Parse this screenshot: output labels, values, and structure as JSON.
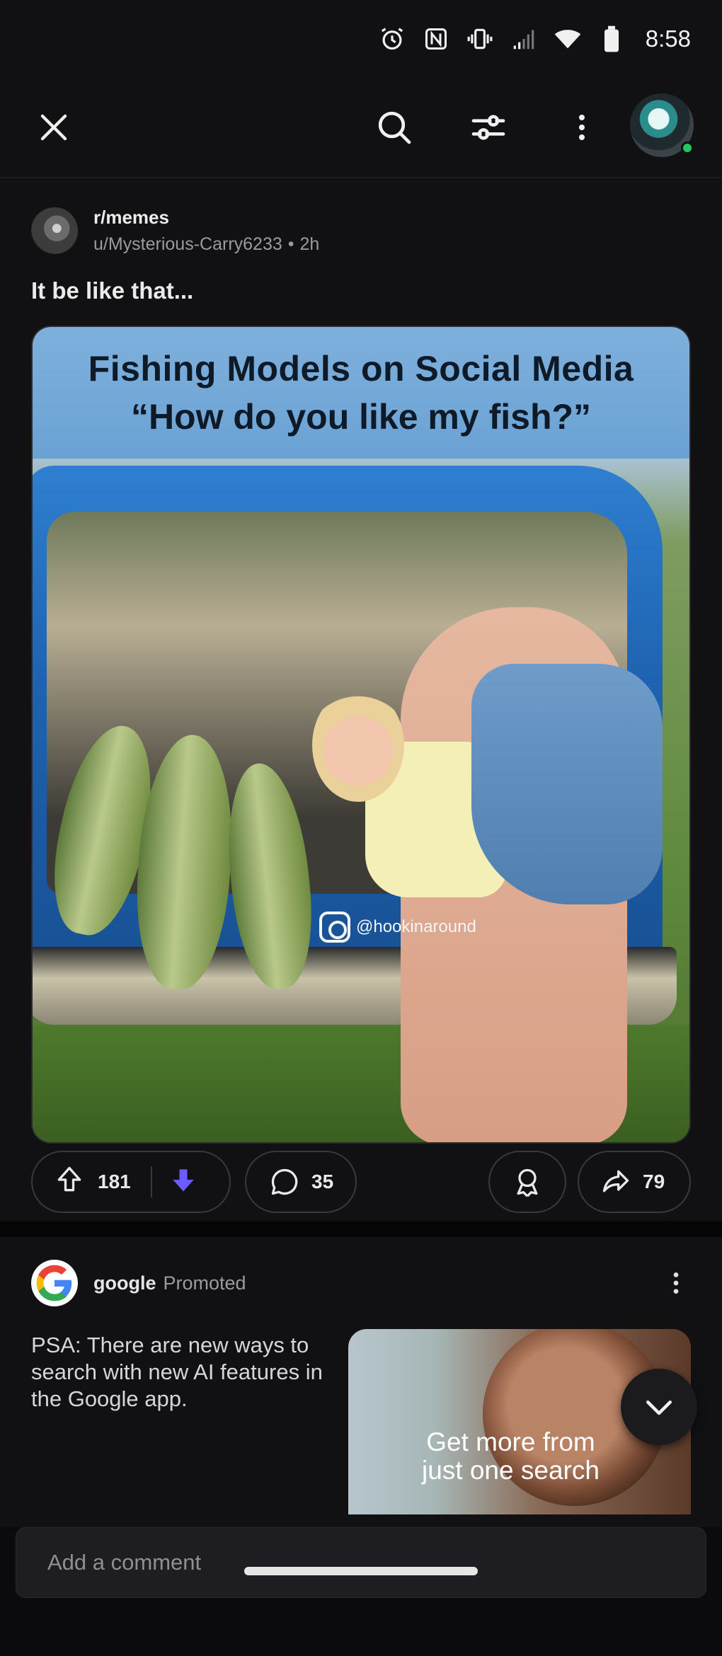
{
  "status_bar": {
    "time": "8:58",
    "icons": [
      "alarm-icon",
      "nfc-icon",
      "vibrate-icon",
      "signal-icon",
      "wifi-icon",
      "battery-icon"
    ]
  },
  "app_bar": {
    "icons": [
      "close-icon",
      "search-icon",
      "filter-icon",
      "more-vertical-icon",
      "avatar"
    ]
  },
  "post": {
    "subreddit": "r/memes",
    "author": "u/Mysterious-Carry6233",
    "separator": "•",
    "age": "2h",
    "title": "It be like that...",
    "meme_caption_line1": "Fishing Models on Social Media",
    "meme_caption_line2": "“How do you like my fish?”",
    "watermark": "@hookinaround",
    "upvotes": "181",
    "comments": "35",
    "shares": "79",
    "vote_state": "downvoted",
    "downvote_color": "#6a5cff"
  },
  "promo": {
    "advertiser": "google",
    "label": "Promoted",
    "text": "PSA: There are new ways to search with new AI features in the Google app.",
    "image_text_line1": "Get more from",
    "image_text_line2": "just one search"
  },
  "comment_bar": {
    "placeholder": "Add a comment"
  }
}
